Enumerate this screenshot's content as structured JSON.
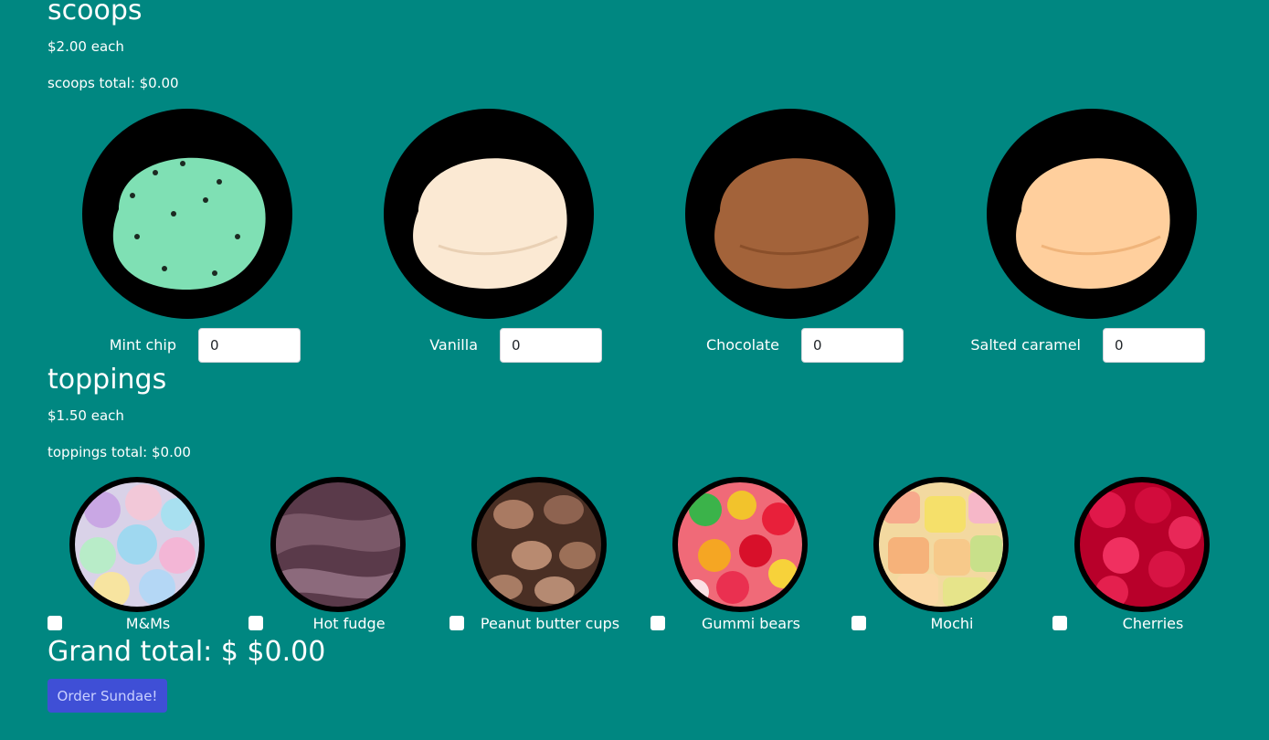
{
  "scoops": {
    "title": "scoops",
    "price_text": "$2.00 each",
    "total_text": "scoops total: $0.00",
    "items": [
      {
        "label": "Mint chip",
        "value": "0",
        "color": "#7fe0b4",
        "icon": "mint-chip-scoop"
      },
      {
        "label": "Vanilla",
        "value": "0",
        "color": "#fbe9d3",
        "icon": "vanilla-scoop"
      },
      {
        "label": "Chocolate",
        "value": "0",
        "color": "#a3633a",
        "icon": "chocolate-scoop"
      },
      {
        "label": "Salted caramel",
        "value": "0",
        "color": "#ffcf9d",
        "icon": "salted-caramel-scoop"
      }
    ]
  },
  "toppings": {
    "title": "toppings",
    "price_text": "$1.50 each",
    "total_text": "toppings total: $0.00",
    "items": [
      {
        "label": "M&Ms",
        "checked": false,
        "icon": "mms-topping"
      },
      {
        "label": "Hot fudge",
        "checked": false,
        "icon": "hot-fudge-topping"
      },
      {
        "label": "Peanut butter cups",
        "checked": false,
        "icon": "peanut-butter-cups-topping"
      },
      {
        "label": "Gummi bears",
        "checked": false,
        "icon": "gummi-bears-topping"
      },
      {
        "label": "Mochi",
        "checked": false,
        "icon": "mochi-topping"
      },
      {
        "label": "Cherries",
        "checked": false,
        "icon": "cherries-topping"
      }
    ]
  },
  "grand_total": "Grand total: $ $0.00",
  "order_button": "Order Sundae!",
  "colors": {
    "background": "#008781",
    "button": "#3f4fd6"
  }
}
